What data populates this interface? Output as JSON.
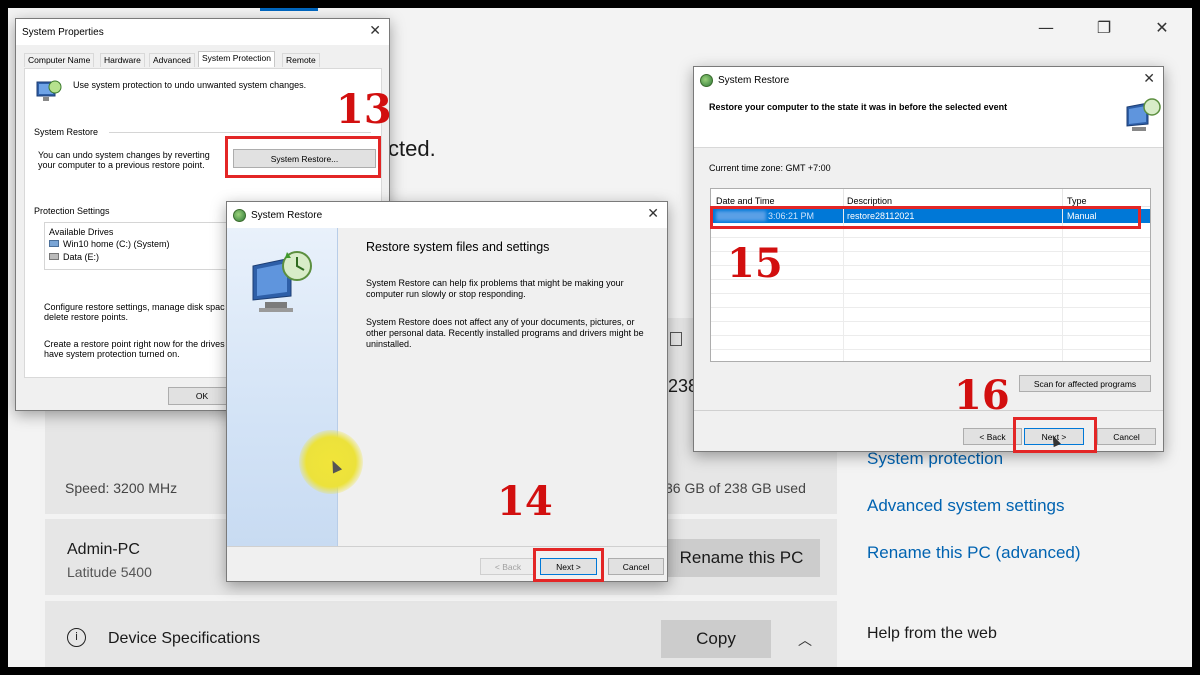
{
  "background": {
    "partial_text": "cted.",
    "speed": "Speed: 3200 MHz",
    "storage_partial": "238",
    "storage_used": "36 GB of 238 GB used",
    "pc_name": "Admin-PC",
    "pc_model": "Latitude 5400",
    "rename_btn": "Rename this PC",
    "device_specs": "Device Specifications",
    "copy_btn": "Copy",
    "links": {
      "system_protection": "System protection",
      "advanced": "Advanced system settings",
      "rename_adv": "Rename this PC (advanced)"
    },
    "help_web": "Help from the web",
    "win_controls": {
      "minimize": "—",
      "restore": "❐",
      "close": "✕"
    }
  },
  "sysprops": {
    "title": "System Properties",
    "tabs": [
      "Computer Name",
      "Hardware",
      "Advanced",
      "System Protection",
      "Remote"
    ],
    "intro": "Use system protection to undo unwanted system changes.",
    "restore_group": "System Restore",
    "restore_desc_1": "You can undo system changes by reverting",
    "restore_desc_2": "your computer to a previous restore point.",
    "restore_btn": "System Restore...",
    "prot_group": "Protection Settings",
    "drives_header": "Available Drives",
    "drive1": "Win10 home (C:) (System)",
    "drive2": "Data (E:)",
    "config_1": "Configure restore settings, manage disk spac",
    "config_2": "delete restore points.",
    "create_1": "Create a restore point right now for the drives t",
    "create_2": "have system protection turned on.",
    "ok_btn": "OK"
  },
  "wizard1": {
    "title": "System Restore",
    "heading": "Restore system files and settings",
    "p1_1": "System Restore can help fix problems that might be making your",
    "p1_2": "computer run slowly or stop responding.",
    "p2_1": "System Restore does not affect any of your documents, pictures, or",
    "p2_2": "other personal data. Recently installed programs and drivers might be",
    "p2_3": "uninstalled.",
    "back_btn": "< Back",
    "next_btn": "Next >",
    "cancel_btn": "Cancel"
  },
  "wizard2": {
    "title": "System Restore",
    "heading": "Restore your computer to the state it was in before the selected event",
    "timezone": "Current time zone: GMT +7:00",
    "columns": [
      "Date and Time",
      "Description",
      "Type"
    ],
    "row": {
      "date": "3:06:21 PM",
      "description": "restore28112021",
      "type": "Manual"
    },
    "scan_btn": "Scan for affected programs",
    "back_btn": "< Back",
    "next_btn": "Next >",
    "cancel_btn": "Cancel"
  },
  "steps": [
    "13",
    "14",
    "15",
    "16"
  ]
}
